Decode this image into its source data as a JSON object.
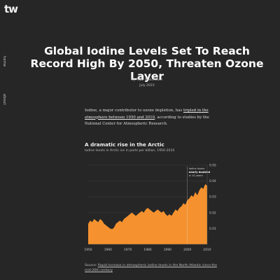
{
  "site": {
    "logo": "tw"
  },
  "nav": {
    "home": "home",
    "about": "about"
  },
  "article": {
    "title": "Global Iodine Levels Set To Reach Record High By 2050, Threaten Ozone Layer",
    "byline": "By Tejal Wakchoure",
    "date": "July 2023",
    "paragraph": {
      "text_before": "Iodine, a major contributor to ozone depletion, has ",
      "link_text": "tripled in the atmosphere between 1950 and 2010",
      "text_after": ", according to studies by the National Center for Atmospheric Research."
    }
  },
  "chart_data": {
    "type": "area",
    "title": "A dramatic rise in the Arctic",
    "subtitle": "Iodine levels in Arctic ice in parts per billion, 1950-2010",
    "x": [
      1950,
      1951,
      1952,
      1953,
      1954,
      1955,
      1956,
      1957,
      1958,
      1959,
      1960,
      1961,
      1962,
      1963,
      1964,
      1965,
      1966,
      1967,
      1968,
      1969,
      1970,
      1971,
      1972,
      1973,
      1974,
      1975,
      1976,
      1977,
      1978,
      1979,
      1980,
      1981,
      1982,
      1983,
      1984,
      1985,
      1986,
      1987,
      1988,
      1989,
      1990,
      1991,
      1992,
      1993,
      1994,
      1995,
      1996,
      1997,
      1998,
      1999,
      2000,
      2001,
      2002,
      2003,
      2004,
      2005,
      2006,
      2007,
      2008,
      2009,
      2010
    ],
    "values": [
      0.013,
      0.015,
      0.014,
      0.016,
      0.015,
      0.014,
      0.016,
      0.015,
      0.013,
      0.012,
      0.011,
      0.01,
      0.0095,
      0.0105,
      0.013,
      0.014,
      0.015,
      0.014,
      0.016,
      0.017,
      0.018,
      0.019,
      0.02,
      0.019,
      0.018,
      0.019,
      0.02,
      0.021,
      0.02,
      0.022,
      0.023,
      0.022,
      0.021,
      0.02,
      0.021,
      0.022,
      0.021,
      0.02,
      0.021,
      0.019,
      0.018,
      0.019,
      0.018,
      0.02,
      0.022,
      0.021,
      0.023,
      0.024,
      0.026,
      0.025,
      0.028,
      0.029,
      0.031,
      0.03,
      0.033,
      0.031,
      0.034,
      0.036,
      0.035,
      0.038,
      0.037
    ],
    "xlim": [
      1950,
      2010
    ],
    "ylim": [
      0,
      0.05
    ],
    "xticks": [
      "1950",
      "1960",
      "1970",
      "1980",
      "1990",
      "2000",
      "2010"
    ],
    "yticks": [
      "0.01",
      "0.02",
      "0.03",
      "0.04",
      "0.05"
    ],
    "annotation": {
      "line1": "Iodine levels",
      "line2": "nearly doubled",
      "line3": "in 10 years",
      "from_year": 2000
    },
    "grid": true,
    "color": "#f5922f"
  },
  "source": {
    "label": "Source: ",
    "link_text": "Rapid increase in atmospheric iodine levels in the North Atlantic since the mid-20th century"
  },
  "colors": {
    "background": "#262626",
    "accent": "#f5922f"
  }
}
